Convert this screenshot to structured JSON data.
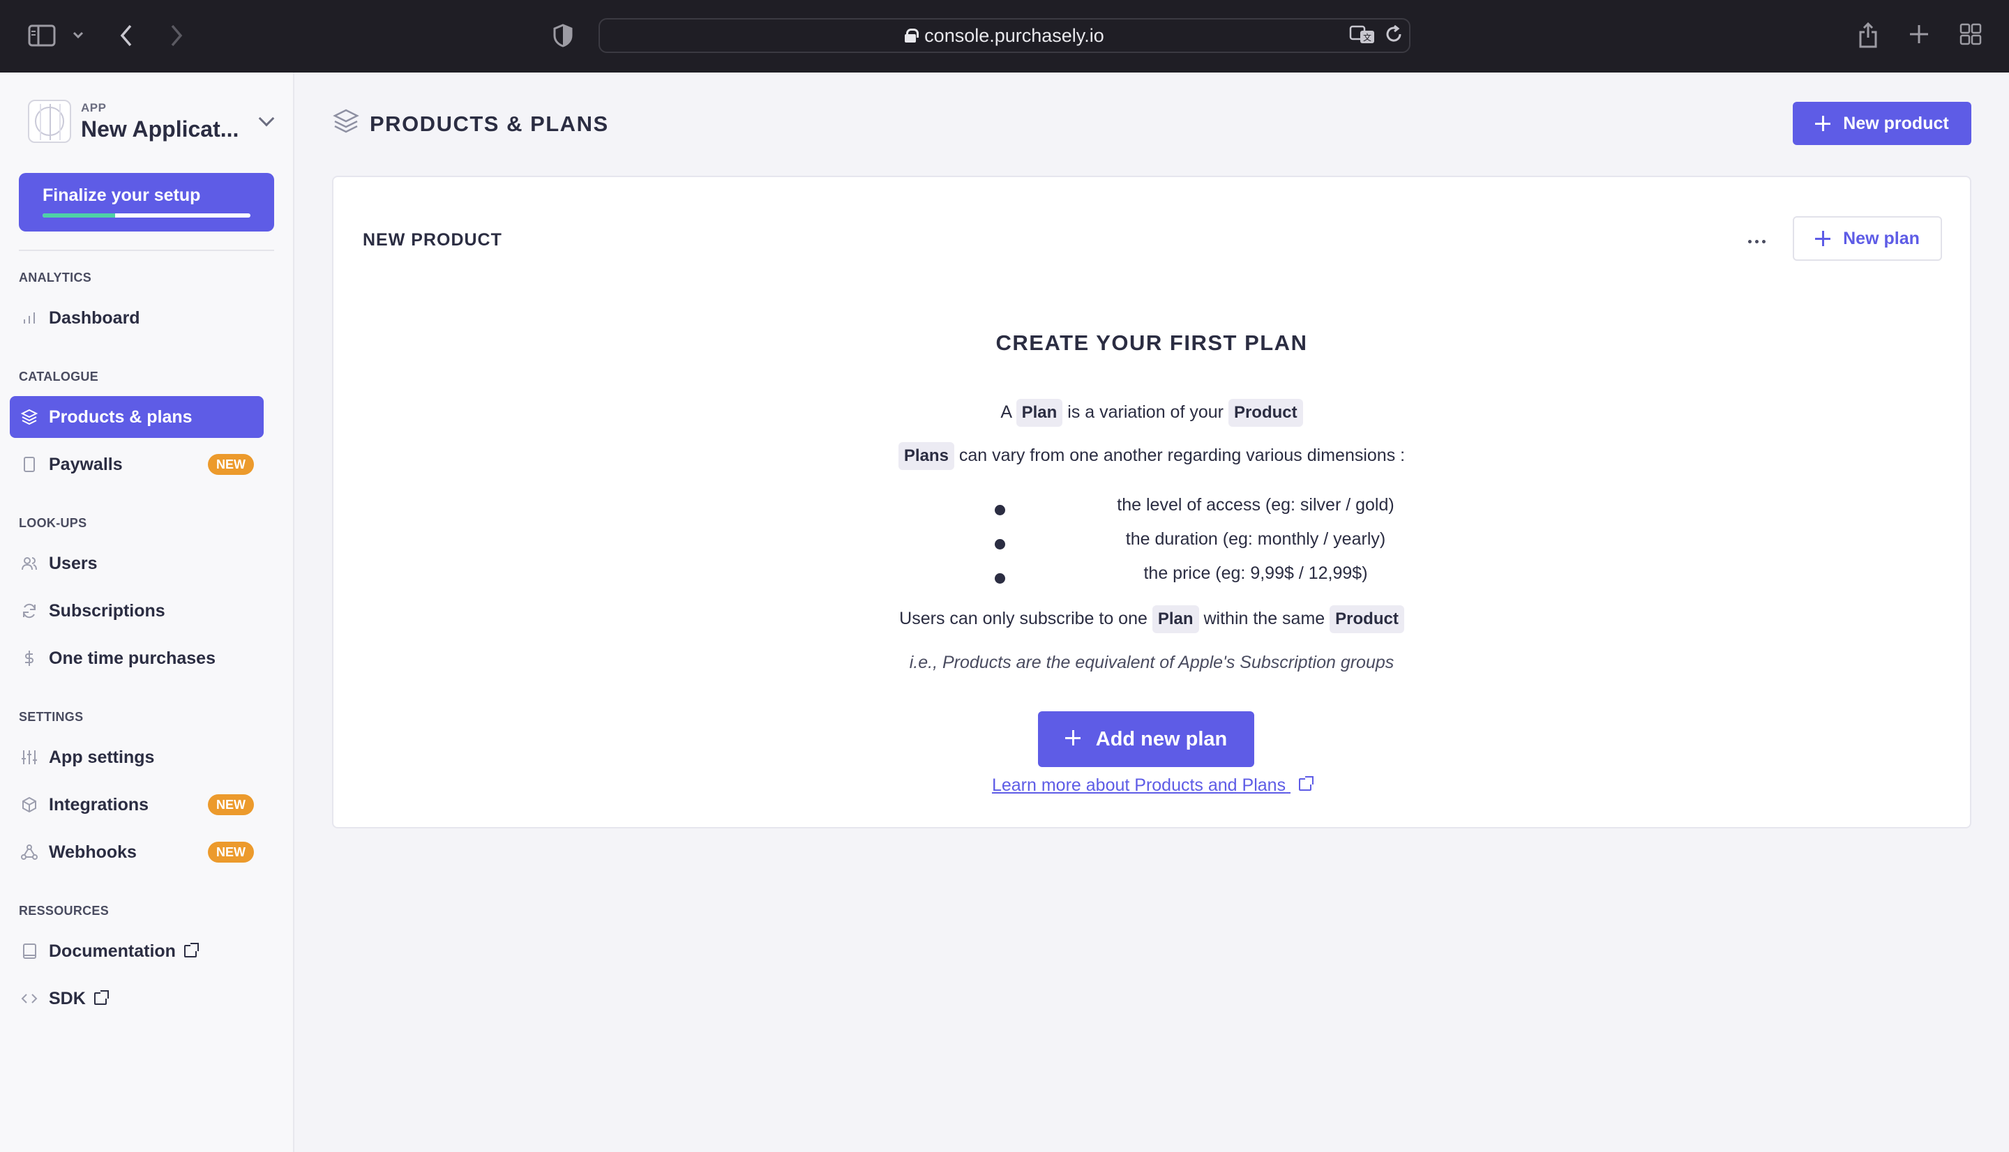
{
  "browser": {
    "url": "console.purchasely.io"
  },
  "sidebar": {
    "app_kicker": "APP",
    "app_name": "New Applicat...",
    "setup": {
      "label": "Finalize your setup",
      "progress": 0.35
    },
    "sections": {
      "analytics": "ANALYTICS",
      "catalogue": "CATALOGUE",
      "lookups": "LOOK-UPS",
      "settings": "SETTINGS",
      "resources": "RESSOURCES"
    },
    "items": {
      "dashboard": "Dashboard",
      "products": "Products & plans",
      "paywalls": "Paywalls",
      "users": "Users",
      "subscriptions": "Subscriptions",
      "one_time": "One time purchases",
      "app_settings": "App settings",
      "integrations": "Integrations",
      "webhooks": "Webhooks",
      "documentation": "Documentation",
      "sdk": "SDK"
    },
    "badge_new": "NEW"
  },
  "header": {
    "title": "PRODUCTS & PLANS",
    "new_product": "New product"
  },
  "card": {
    "title": "NEW PRODUCT",
    "new_plan": "New plan",
    "empty_title": "CREATE YOUR FIRST PLAN",
    "l1_a": "A",
    "l1_plan": "Plan",
    "l1_b": "is a variation of your",
    "l1_product": "Product",
    "l2_plans": "Plans",
    "l2_b": "can vary from one another regarding various dimensions :",
    "bullets": [
      "the level of access (eg: silver / gold)",
      "the duration (eg: monthly / yearly)",
      "the price (eg: 9,99$ / 12,99$)"
    ],
    "l3_a": "Users can only subscribe to one",
    "l3_plan": "Plan",
    "l3_b": "within the same",
    "l3_product": "Product",
    "note": "i.e., Products are the equivalent of Apple's Subscription groups",
    "add_plan": "Add new plan",
    "learn_more": "Learn more about Products and Plans"
  }
}
